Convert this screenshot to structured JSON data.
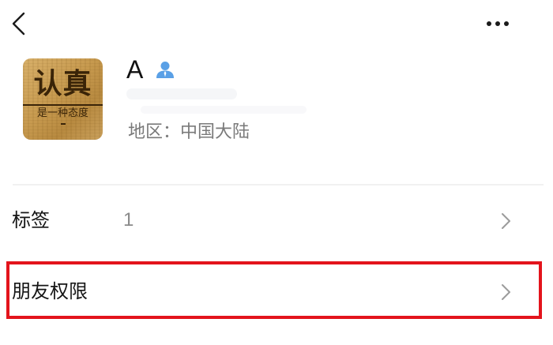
{
  "header": {
    "back_icon": "chevron-left-icon",
    "more_icon": "more-horizontal-icon"
  },
  "profile": {
    "avatar": {
      "main_text": "认真",
      "sub_text": "是一种态度"
    },
    "name": "A",
    "name_badge_icon": "user-icon",
    "region": "地区：中国大陆"
  },
  "rows": {
    "tags": {
      "label": "标签",
      "value": "1",
      "icon": "chevron-right-icon"
    },
    "friend_permissions": {
      "label": "朋友权限",
      "icon": "chevron-right-icon"
    }
  },
  "colors": {
    "highlight": "#e3141c",
    "user_icon": "#5aa0e6",
    "secondary_text": "#7a7a7a"
  }
}
